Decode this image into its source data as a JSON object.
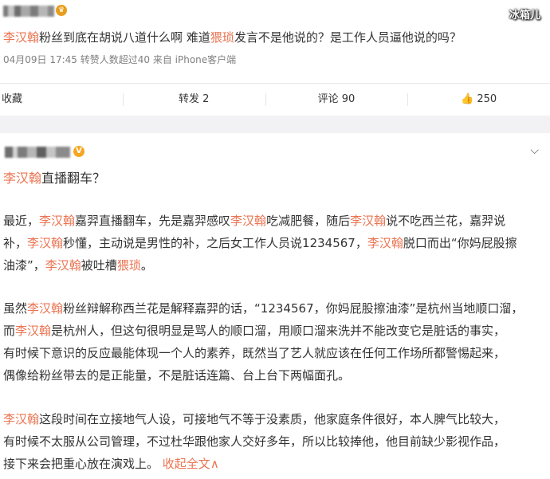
{
  "watermark": "冰箱儿",
  "post1": {
    "mention": "李汉翰",
    "text_a": "粉丝到底在胡说八道什么啊 难道",
    "keyword": "猥琐",
    "text_b": "发言不是他说的？是工作人员逼他说的吗？",
    "meta": "04月09日 17:45 转赞人数超过40 来自 iPhone客户端",
    "actions": {
      "collect": "收藏",
      "repost": "转发 2",
      "comment": "评论 90",
      "like": "250"
    }
  },
  "post2": {
    "title_mention": "李汉翰",
    "title_rest": "直播翻车？",
    "name": "李汉翰",
    "word_wei_suo": "猥琐",
    "p1": {
      "l1_a": "最近，",
      "l1_b": "嘉羿直播翻车，先是嘉羿感叹",
      "l1_c": "吃减肥餐，随后",
      "l1_d": "说不吃西兰花，嘉羿说",
      "l2_a": "补，",
      "l2_b": "秒懂，主动说是男性的补，之后女工作人员说1234567，",
      "l2_c": "脱口而出“你妈屁股擦",
      "l3_a": "油漆”，",
      "l3_b": "被吐槽",
      "l3_end": "。"
    },
    "p2": {
      "l1_a": "虽然",
      "l1_b": "粉丝辩解称西兰花是解释嘉羿的话，“1234567，你妈屁股擦油漆”是杭州当地顺口溜，",
      "l2_a": "而",
      "l2_b": "是杭州人，但这句很明显是骂人的顺口溜，用顺口溜来洗并不能改变它是脏话的事实，",
      "l3": "有时候下意识的反应最能体现一个人的素养，既然当了艺人就应该在任何工作场所都警惕起来，",
      "l4": "偶像给粉丝带去的是正能量，不是脏话连篇、台上台下两幅面孔。"
    },
    "p3": {
      "l1_b": "这段时间在立接地气人设，可接地气不等于没素质，他家庭条件很好，本人脾气比较大，",
      "l2": "有时候不太服从公司管理，不过杜华跟他家人交好多年，所以比较捧他，他目前缺少影视作品，",
      "l3": "接下来会把重心放在演戏上。",
      "collapse": "收起全文",
      "collapse_arrow": "∧"
    }
  },
  "icons": {
    "thumb": "thumbs-up-icon",
    "chevron": "chevron-down-icon",
    "vip": "crown-badge-icon",
    "verified": "v-verified-icon"
  }
}
